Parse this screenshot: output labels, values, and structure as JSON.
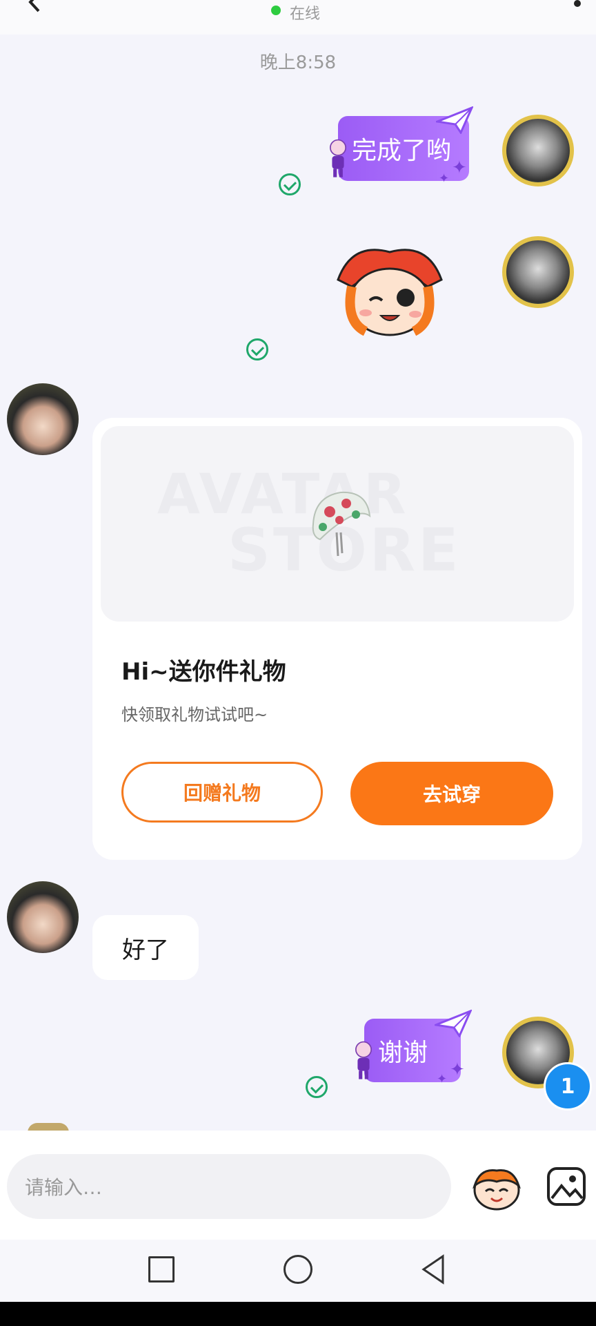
{
  "header": {
    "status_text": "在线",
    "status_color": "#2ecc40"
  },
  "timestamp": "晚上8:58",
  "messages": [
    {
      "sender": "self",
      "type": "sticker",
      "text": "完成了哟",
      "icon": "paper-plane-icon",
      "status": "sent-check"
    },
    {
      "sender": "self",
      "type": "sticker-image",
      "icon": "cartoon-sticker",
      "status": "sent-check"
    },
    {
      "sender": "other",
      "type": "gift-card",
      "watermark": [
        "AVATAR",
        "STORE"
      ],
      "item_icon": "gift-item-image",
      "title": "Hi~送你件礼物",
      "subtitle": "快领取礼物试试吧~",
      "btn_return": "回赠礼物",
      "btn_try": "去试穿"
    },
    {
      "sender": "other",
      "type": "text",
      "text": "好了"
    },
    {
      "sender": "self",
      "type": "sticker",
      "text": "谢谢",
      "icon": "paper-plane-icon",
      "status": "sent-check"
    }
  ],
  "badge": {
    "count": "1"
  },
  "input": {
    "placeholder": "请输入…"
  },
  "colors": {
    "accent": "#fb7716",
    "sticker_purple": "#9b5cf5",
    "check_green": "#1fa76a",
    "badge_blue": "#1a8ff0"
  }
}
